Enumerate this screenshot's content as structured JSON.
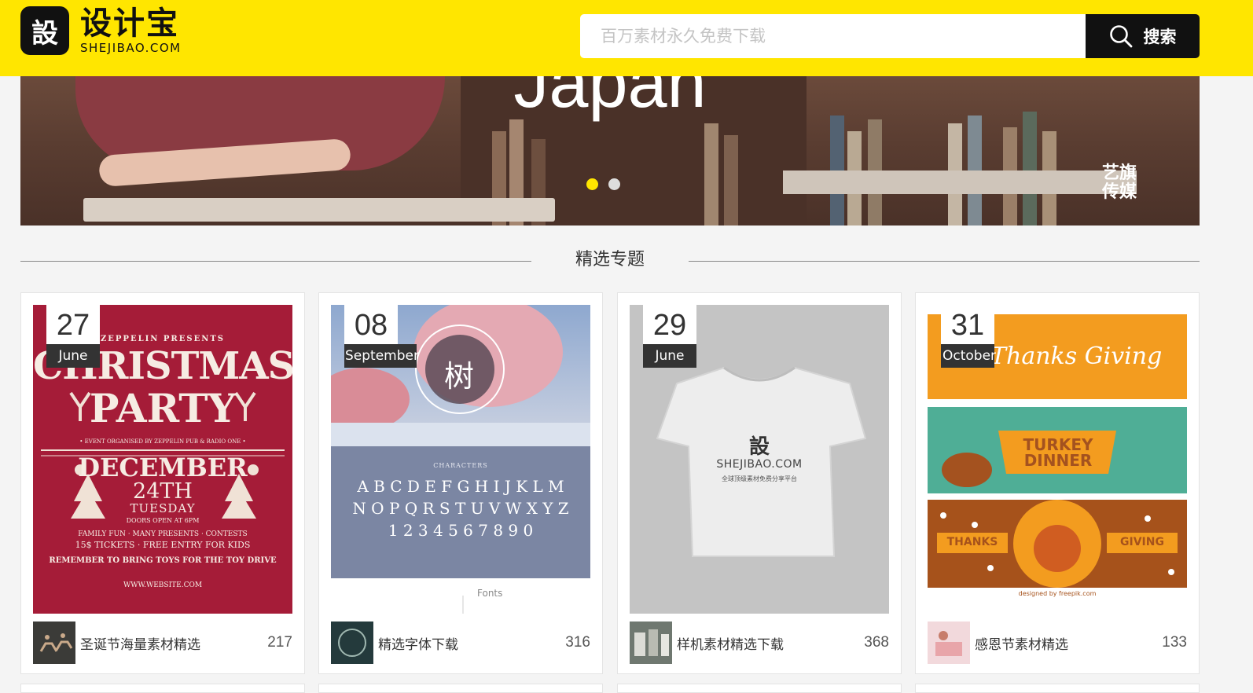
{
  "header": {
    "logo_mark": "設",
    "logo_cn": "设计宝",
    "logo_en": "SHEJIBAO.COM",
    "search_placeholder": "百万素材永久免费下载",
    "search_button": "搜索"
  },
  "banner": {
    "title": "Japan",
    "watermark_line1": "艺旗",
    "watermark_line2": "传媒",
    "active_slide": 1,
    "slides": 2
  },
  "section": {
    "title": "精选专题"
  },
  "cards": [
    {
      "day": "27",
      "month": "June",
      "title": "圣诞节海量素材精选",
      "count": "217"
    },
    {
      "day": "08",
      "month": "September",
      "title": "精选字体下载",
      "count": "316"
    },
    {
      "day": "29",
      "month": "June",
      "title": "样机素材精选下载",
      "count": "368"
    },
    {
      "day": "31",
      "month": "October",
      "title": "感恩节素材精选",
      "count": "133"
    }
  ],
  "thumbs": {
    "christmas": {
      "presents": "ZEPPELIN PRESENTS",
      "line1": "CHRISTMAS",
      "line2": "PARTY",
      "organised": "• EVENT ORGANISED BY ZEPPELIN PUB & RADIO ONE •",
      "month": "DECEMBER",
      "date": "24TH",
      "weekday": "TUESDAY",
      "doors": "DOORS OPEN AT 6PM",
      "info1": "FAMILY FUN · MANY PRESENTS · CONTESTS",
      "info2": "15$ TICKETS · FREE ENTRY FOR KIDS",
      "reminder": "REMEMBER TO BRING TOYS FOR THE TOY DRIVE",
      "website": "WWW.WEBSITE.COM"
    },
    "fonts": {
      "stamp": "树",
      "characters": "CHARACTERS",
      "row1": "A B C D E F G H I J K L M",
      "row2": "N O P Q R S T U V W X Y Z",
      "row3": "1 2 3 4 5 6 7 8 9 0",
      "label": "Fonts"
    },
    "shirt": {
      "mark": "設",
      "brand": "SHEJIBAO.COM",
      "tagline": "全球顶级素材免费分享平台"
    },
    "thanks": {
      "top": "Thanks Giving",
      "mid": "TURKEY DINNER",
      "left": "THANKS",
      "right": "GIVING",
      "credit": "designed by freepik.com"
    }
  },
  "colors": {
    "brand_yellow": "#ffe600",
    "black": "#111111"
  }
}
